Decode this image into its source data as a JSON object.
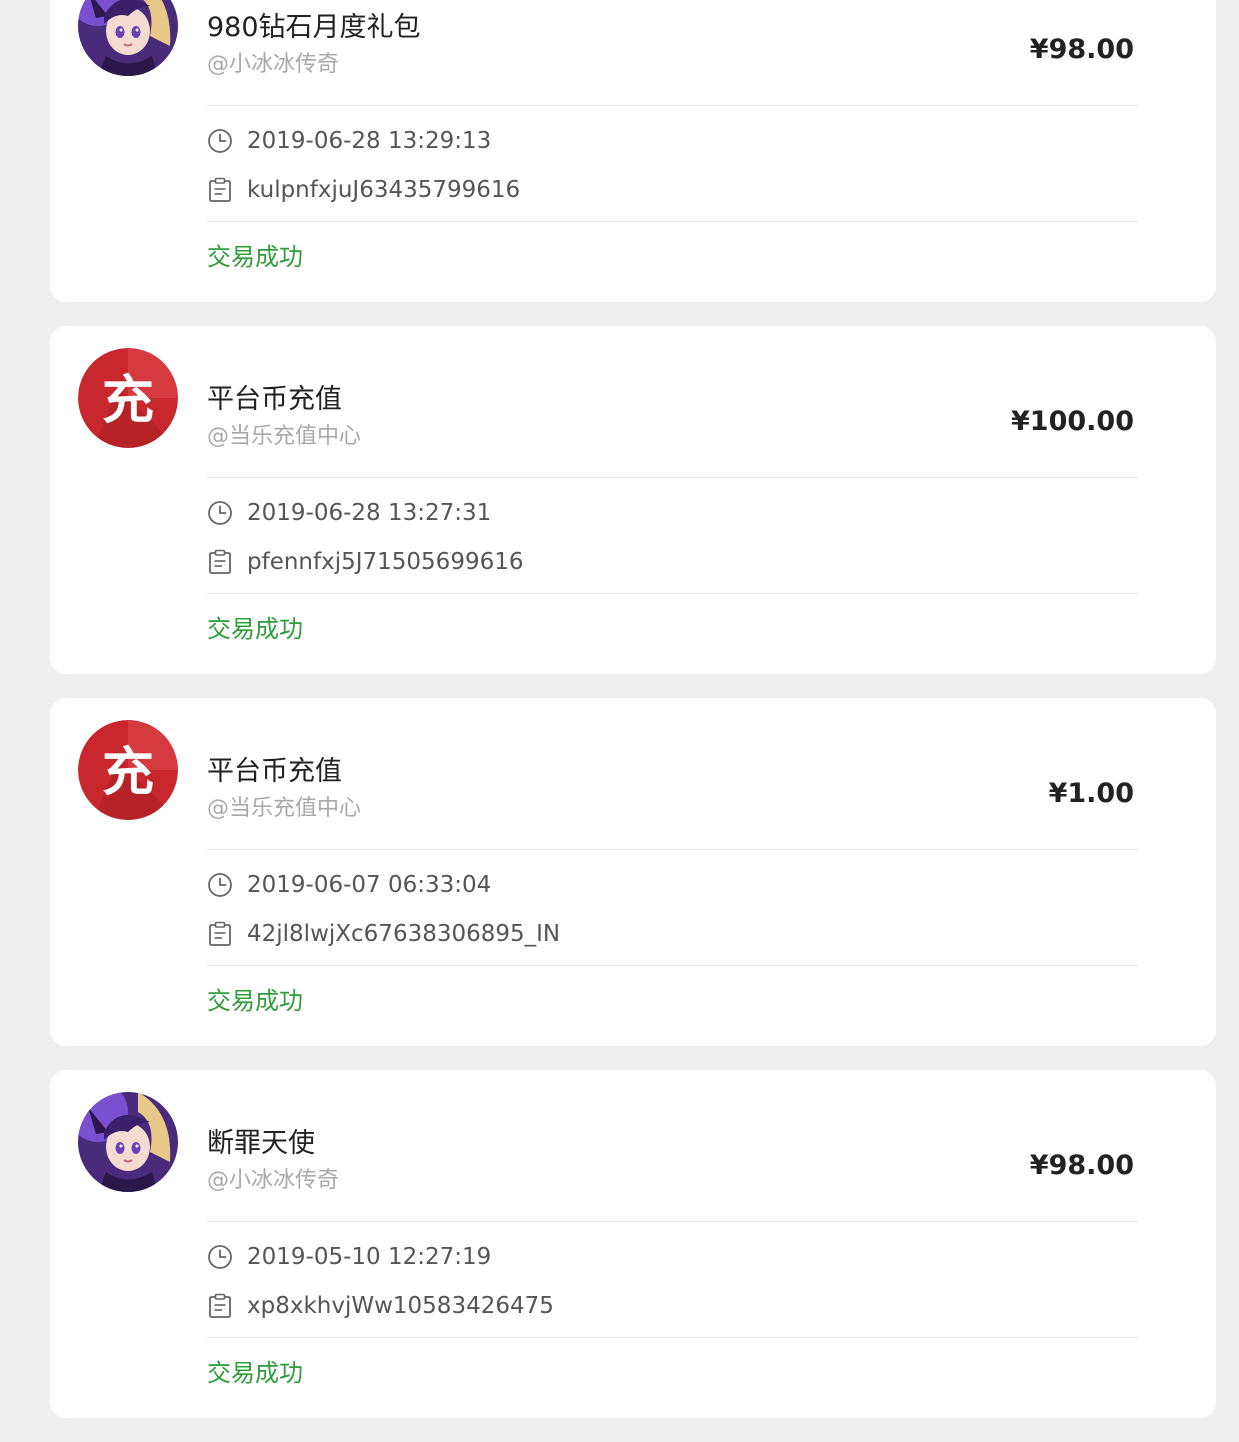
{
  "colors": {
    "status": "#2e9d3a",
    "background": "#efefef",
    "card": "#ffffff",
    "recharge_red": "#c8282d"
  },
  "transactions": [
    {
      "avatar": "game-character-avatar",
      "title": "980钻石月度礼包",
      "merchant": "@小冰冰传奇",
      "amount": "¥98.00",
      "time": "2019-06-28 13:29:13",
      "order_id": "kulpnfxjuJ63435799616",
      "status": "交易成功"
    },
    {
      "avatar": "recharge-avatar",
      "avatar_text": "充",
      "title": "平台币充值",
      "merchant": "@当乐充值中心",
      "amount": "¥100.00",
      "time": "2019-06-28 13:27:31",
      "order_id": "pfennfxj5J71505699616",
      "status": "交易成功"
    },
    {
      "avatar": "recharge-avatar",
      "avatar_text": "充",
      "title": "平台币充值",
      "merchant": "@当乐充值中心",
      "amount": "¥1.00",
      "time": "2019-06-07 06:33:04",
      "order_id": "42jl8lwjXc67638306895_IN",
      "status": "交易成功"
    },
    {
      "avatar": "game-character-avatar",
      "title": "断罪天使",
      "merchant": "@小冰冰传奇",
      "amount": "¥98.00",
      "time": "2019-05-10 12:27:19",
      "order_id": "xp8xkhvjWw10583426475",
      "status": "交易成功"
    }
  ]
}
